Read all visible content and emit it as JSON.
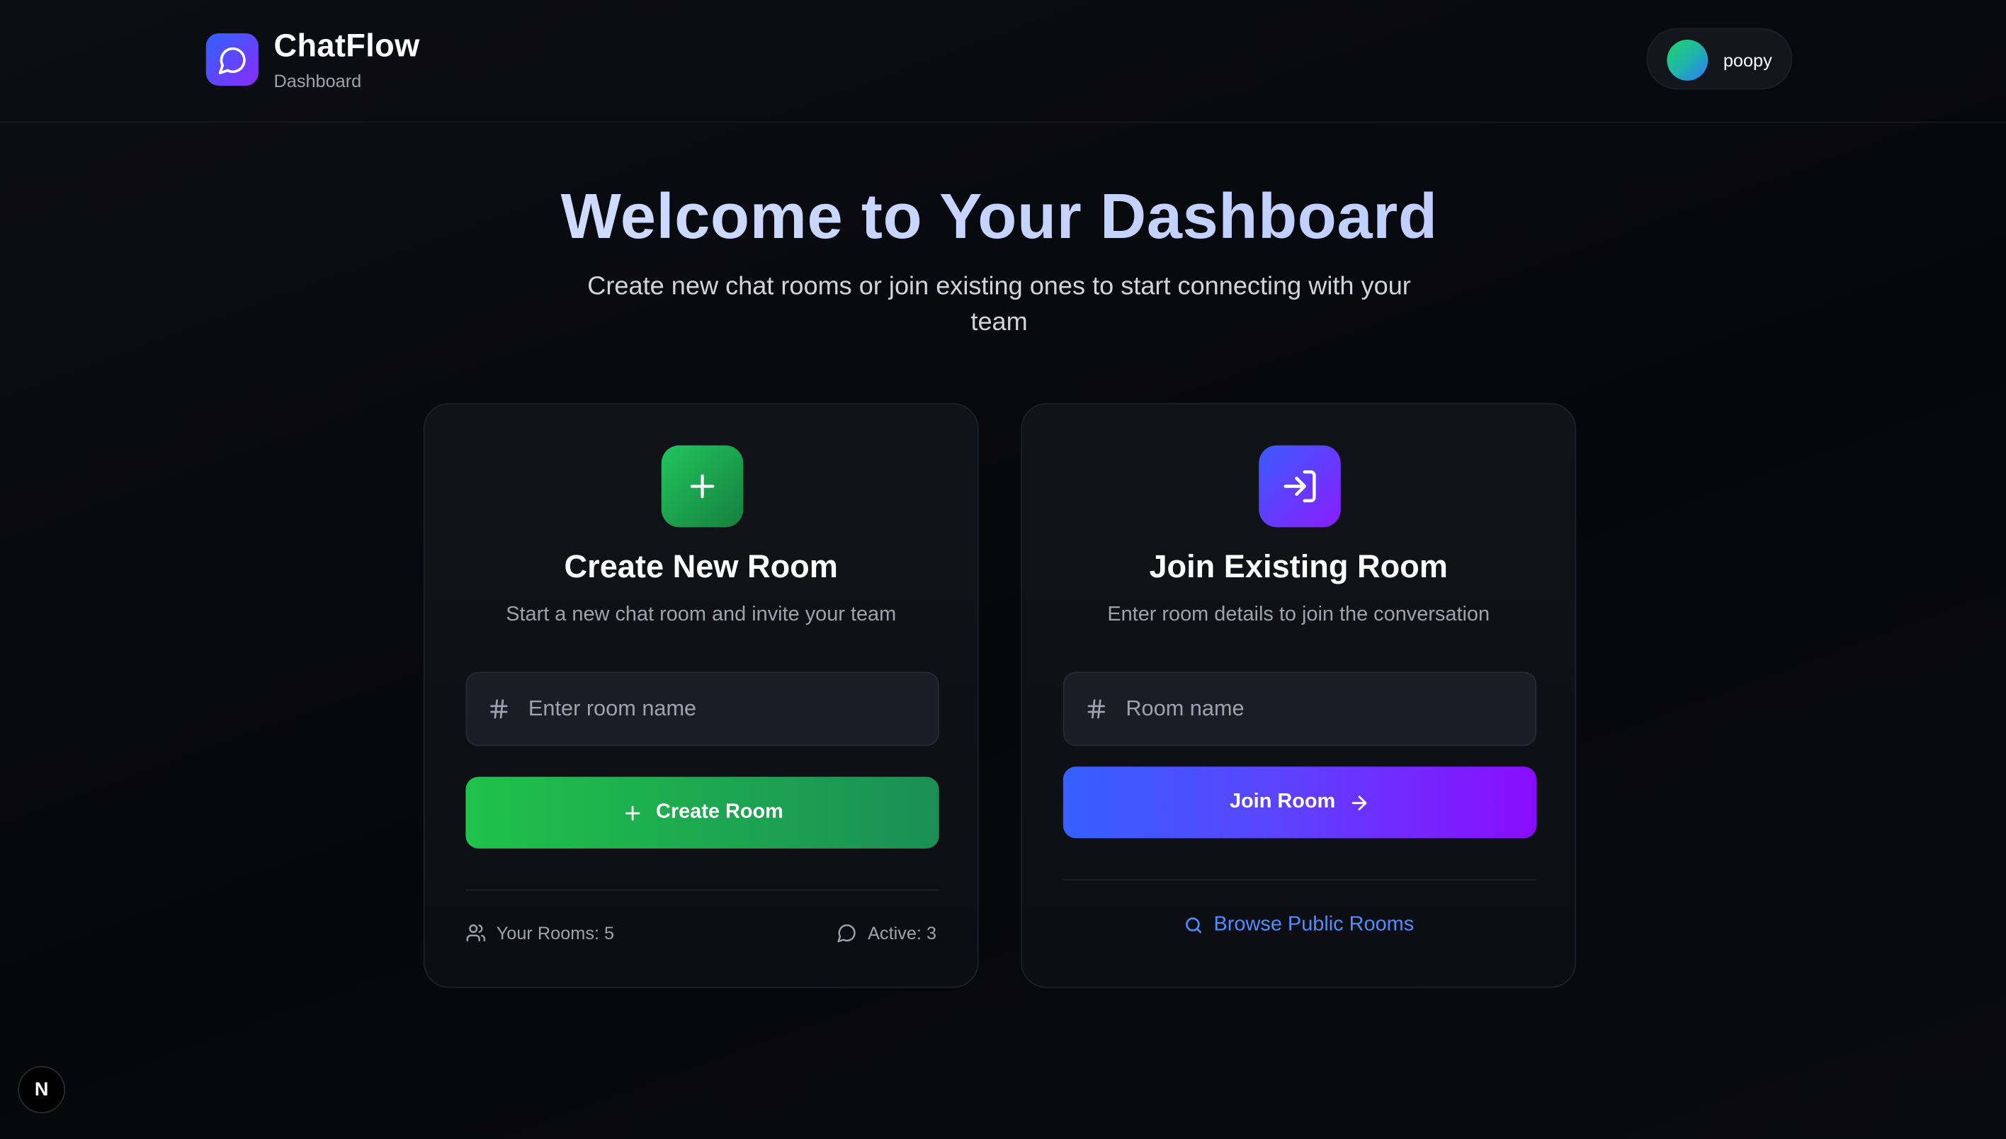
{
  "header": {
    "brand_title": "ChatFlow",
    "brand_subtitle": "Dashboard",
    "username": "poopy"
  },
  "hero": {
    "title": "Welcome to Your Dashboard",
    "subtitle": "Create new chat rooms or join existing ones to start connecting with your team"
  },
  "create_card": {
    "title": "Create New Room",
    "description": "Start a new chat room and invite your team",
    "input_placeholder": "Enter room name",
    "input_value": "",
    "button_label": "Create Room",
    "stat_rooms": "Your Rooms: 5",
    "stat_active": "Active: 3"
  },
  "join_card": {
    "title": "Join Existing Room",
    "description": "Enter room details to join the conversation",
    "input_placeholder": "Room name",
    "input_value": "",
    "button_label": "Join Room",
    "browse_label": "Browse Public Rooms"
  },
  "badge": {
    "label": "N"
  },
  "colors": {
    "accent_green": "#22c55e",
    "accent_blue": "#3560ff",
    "accent_purple": "#8a0cff",
    "link_blue": "#4f8dff",
    "background": "#07080c"
  }
}
